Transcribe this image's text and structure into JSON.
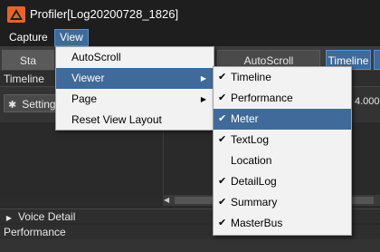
{
  "window": {
    "title": "Profiler[Log20200728_1826]",
    "app_icon": "profiler-logo-icon"
  },
  "menubar": {
    "items": [
      {
        "label": "Capture"
      },
      {
        "label": "View"
      }
    ]
  },
  "toolbar": {
    "start_label": "Sta",
    "autoscroll_label": "AutoScroll",
    "timeline_label": "Timeline"
  },
  "timeline": {
    "header": "Timeline",
    "settings_label": "Setting",
    "right_value": "4.000",
    "scroll_left_icon": "triangle-left-icon"
  },
  "voice_detail": {
    "label": "Voice Detail",
    "icon": "triangle-right-icon"
  },
  "performance": {
    "header": "Performance"
  },
  "view_menu": {
    "items": [
      {
        "label": "AutoScroll",
        "selected": false,
        "submenu": false
      },
      {
        "label": "Viewer",
        "selected": true,
        "submenu": true
      },
      {
        "label": "Page",
        "selected": false,
        "submenu": true
      },
      {
        "label": "Reset View Layout",
        "selected": false,
        "submenu": false
      }
    ]
  },
  "viewer_submenu": {
    "items": [
      {
        "label": "Timeline",
        "checked": true,
        "selected": false
      },
      {
        "label": "Performance",
        "checked": true,
        "selected": false
      },
      {
        "label": "Meter",
        "checked": true,
        "selected": true
      },
      {
        "label": "TextLog",
        "checked": true,
        "selected": false
      },
      {
        "label": "Location",
        "checked": false,
        "selected": false
      },
      {
        "label": "DetailLog",
        "checked": true,
        "selected": false
      },
      {
        "label": "Summary",
        "checked": true,
        "selected": false
      },
      {
        "label": "MasterBus",
        "checked": true,
        "selected": false
      }
    ]
  },
  "colors": {
    "accent": "#3f6a99",
    "background": "#2b2b2b",
    "menu_background": "#f2f2f2"
  }
}
